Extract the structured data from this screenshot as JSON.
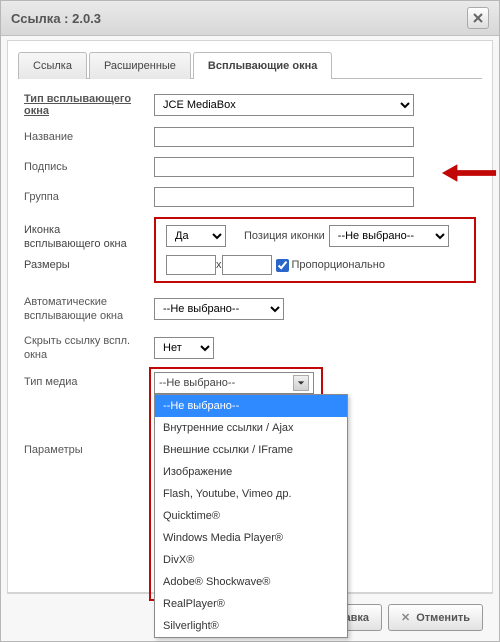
{
  "window": {
    "title": "Ссылка : 2.0.3"
  },
  "tabs": {
    "link": "Ссылка",
    "advanced": "Расширенные",
    "popups": "Всплывающие окна"
  },
  "popup_type": {
    "label": "Тип всплывающего окна",
    "value": "JCE MediaBox"
  },
  "fields": {
    "title_label": "Название",
    "caption_label": "Подпись",
    "group_label": "Группа",
    "icon_label_l1": "Иконка",
    "icon_label_l2": "всплывающего окна",
    "icon_value": "Да",
    "icon_pos_label": "Позиция иконки",
    "icon_pos_value": "--Не выбрано--",
    "dims_label": "Размеры",
    "dims_x": "x",
    "prop_label": "Пропорционально",
    "auto_l1": "Автоматические",
    "auto_l2": "всплывающие окна",
    "auto_value": "--Не выбрано--",
    "hide_l1": "Скрыть ссылку вспл.",
    "hide_l2": "окна",
    "hide_value": "Нет",
    "media_label": "Тип медиа",
    "media_value": "--Не выбрано--",
    "params_label": "Параметры"
  },
  "media_options": {
    "o0": "--Не выбрано--",
    "o1": "Внутренние ссылки / Ajax",
    "o2": "Внешние ссылки / IFrame",
    "o3": "Изображение",
    "o4": "Flash, Youtube, Vimeo др.",
    "o5": "Quicktime®",
    "o6": "Windows Media Player®",
    "o7": "DivX®",
    "o8": "Adobe® Shockwave®",
    "o9": "RealPlayer®",
    "o10": "Silverlight®"
  },
  "buttons": {
    "help": "Справка",
    "cancel": "Отменить"
  }
}
